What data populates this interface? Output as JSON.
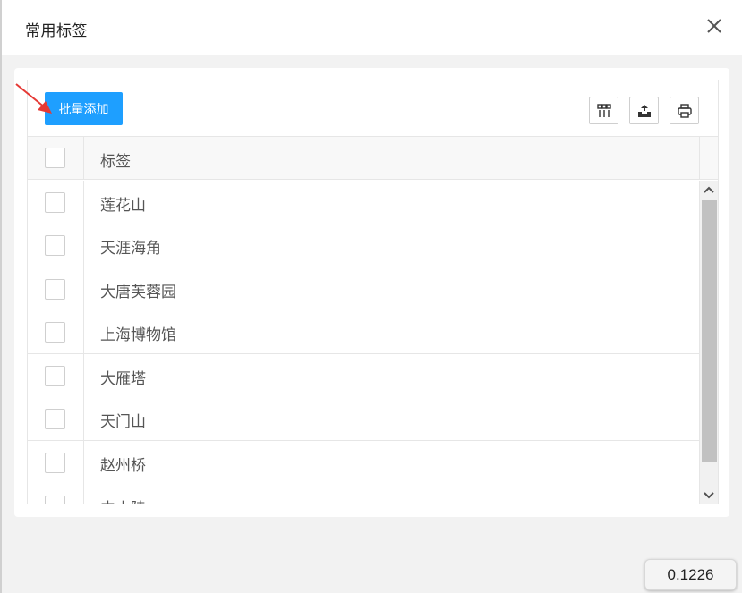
{
  "dialog": {
    "title": "常用标签",
    "close_icon": "close-icon"
  },
  "toolbar": {
    "batch_add_label": "批量添加",
    "icons": [
      "columns-icon",
      "export-icon",
      "print-icon"
    ],
    "accent_color": "#1e9fff"
  },
  "table": {
    "header_label": "标签",
    "rows": [
      {
        "label": "莲花山"
      },
      {
        "label": "天涯海角"
      },
      {
        "label": "大唐芙蓉园"
      },
      {
        "label": "上海博物馆"
      },
      {
        "label": "大雁塔"
      },
      {
        "label": "天门山"
      },
      {
        "label": "赵州桥"
      },
      {
        "label": "中山陵"
      }
    ]
  },
  "badge": {
    "value": "0.1226"
  },
  "annotation": {
    "arrow_color": "#e53935"
  }
}
